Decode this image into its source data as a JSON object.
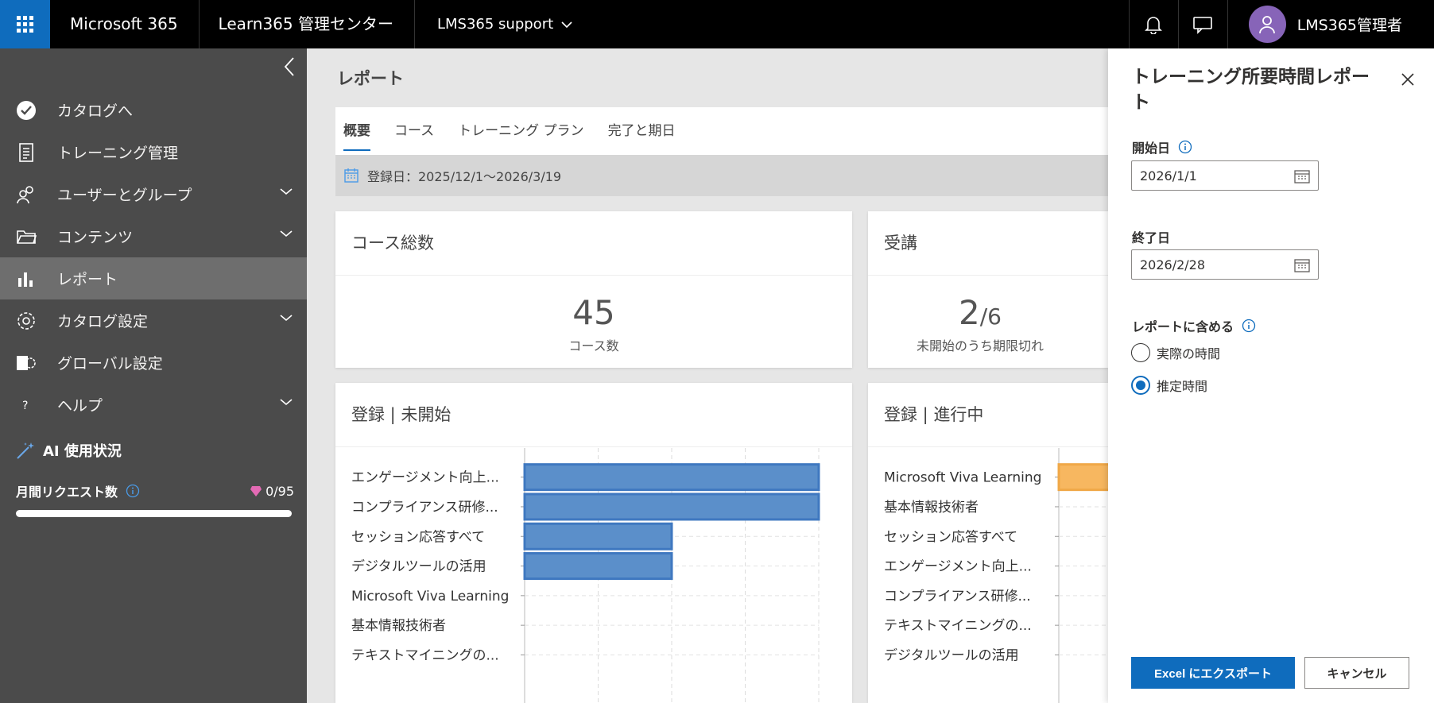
{
  "topbar": {
    "brand": "Microsoft 365",
    "app": "Learn365 管理センター",
    "tenant": "LMS365 support",
    "user": "LMS365管理者"
  },
  "sidebar": {
    "items": [
      {
        "label": "カタログへ",
        "icon": "catalog-check-icon",
        "chevron": false
      },
      {
        "label": "トレーニング管理",
        "icon": "training-doc-icon",
        "chevron": false
      },
      {
        "label": "ユーザーとグループ",
        "icon": "users-icon",
        "chevron": true
      },
      {
        "label": "コンテンツ",
        "icon": "folder-icon",
        "chevron": true
      },
      {
        "label": "レポート",
        "icon": "bar-chart-icon",
        "chevron": false,
        "active": true
      },
      {
        "label": "カタログ設定",
        "icon": "gear-icon",
        "chevron": true
      },
      {
        "label": "グローバル設定",
        "icon": "global-settings-icon",
        "chevron": false
      },
      {
        "label": "ヘルプ",
        "icon": "help-icon",
        "chevron": true
      }
    ],
    "ai": {
      "title": "AI 使用状況",
      "request_label": "月間リクエスト数",
      "count": "0/95",
      "progress": 0
    }
  },
  "main": {
    "title": "レポート",
    "tabs": [
      {
        "label": "概要",
        "active": true
      },
      {
        "label": "コース"
      },
      {
        "label": "トレーニング プラン"
      },
      {
        "label": "完了と期日"
      }
    ],
    "filter": "登録日：2025/12/1〜2026/3/19",
    "cards": {
      "courses": {
        "title": "コース総数",
        "value": "45",
        "label": "コース数"
      },
      "attend": {
        "title": "受講",
        "value": "2",
        "total": "/6",
        "label": "未開始のうち期限切れ"
      }
    }
  },
  "chart_data": [
    {
      "type": "bar",
      "title": "登録 | 未開始",
      "orientation": "horizontal",
      "categories": [
        "エンゲージメント向上...",
        "コンプライアンス研修...",
        "セッション応答すべて",
        "デジタルツールの活用",
        "Microsoft Viva Learning",
        "基本情報技術者",
        "テキストマイニングの..."
      ],
      "values": [
        4,
        4,
        2,
        2,
        0,
        0,
        0
      ],
      "xlim": [
        0,
        4
      ],
      "color": "#5b8fca"
    },
    {
      "type": "bar",
      "title": "登録 | 進行中",
      "orientation": "horizontal",
      "categories": [
        "Microsoft Viva Learning",
        "基本情報技術者",
        "セッション応答すべて",
        "エンゲージメント向上...",
        "コンプライアンス研修...",
        "テキストマイニングの...",
        "デジタルツールの活用"
      ],
      "values": [
        1,
        0,
        0,
        0,
        0,
        0,
        0
      ],
      "color": "#f7b760"
    }
  ],
  "panel": {
    "title": "トレーニング所要時間レポート",
    "start_label": "開始日",
    "start_value": "2026/1/1",
    "end_label": "終了日",
    "end_value": "2026/2/28",
    "include_label": "レポートに含める",
    "options": [
      {
        "label": "実際の時間",
        "checked": false
      },
      {
        "label": "推定時間",
        "checked": true
      }
    ],
    "export_label": "Excel にエクスポート",
    "cancel_label": "キャンセル"
  },
  "colors": {
    "accent": "#0f6cbd",
    "sidebar": "#4b4b4b",
    "bar_blue": "#5b8fca",
    "bar_orange": "#f7b760"
  }
}
